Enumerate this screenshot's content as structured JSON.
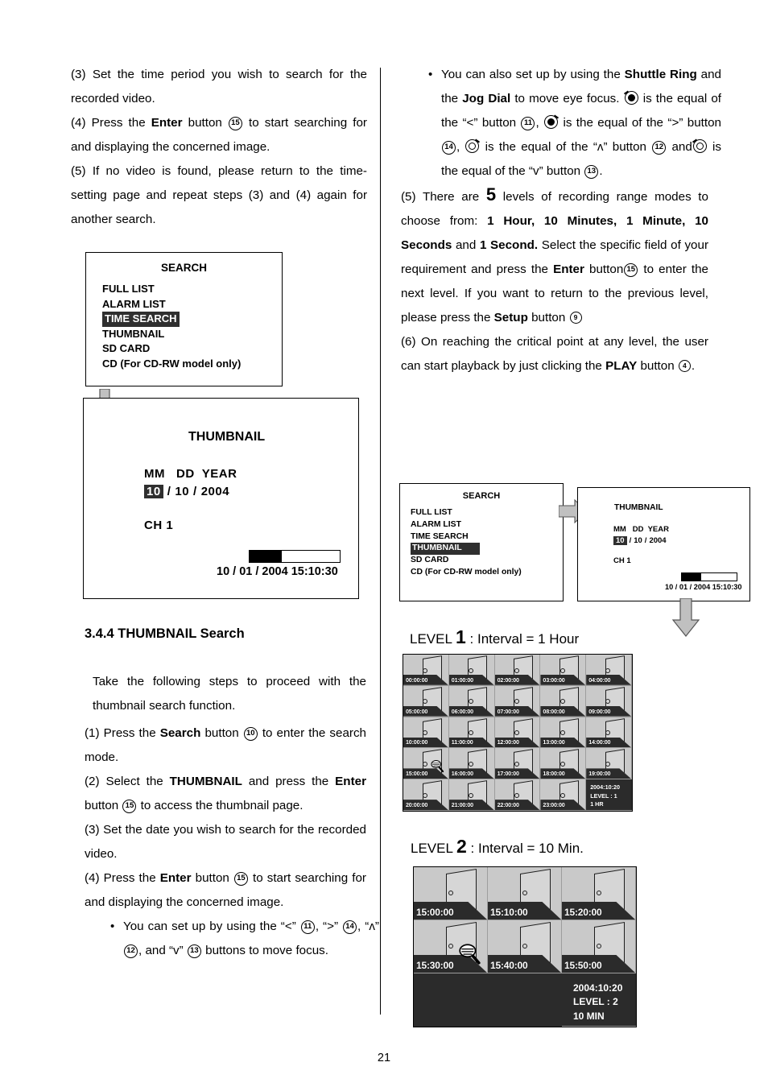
{
  "page": {
    "number": "21"
  },
  "left_column": {
    "steps": [
      {
        "label": "(3)",
        "text": "Set the time period you wish to search for the recorded video."
      },
      {
        "label": "(4)",
        "text_a": "Press the ",
        "bold_a": "Enter",
        "text_b": " button ",
        "badge": "15",
        "text_c": " to start searching for and displaying the concerned image."
      },
      {
        "label": "(5)",
        "text": "If no video is found, please return to the time-setting page and repeat steps (3) and (4) again for another search."
      }
    ],
    "search_menu": {
      "title": "SEARCH",
      "items": [
        {
          "label": "FULL LIST",
          "selected": false
        },
        {
          "label": "ALARM LIST",
          "selected": false
        },
        {
          "label": "TIME SEARCH",
          "selected": true
        },
        {
          "label": "THUMBNAIL",
          "selected": false
        },
        {
          "label": "SD CARD",
          "selected": false
        },
        {
          "label": "CD (For CD-RW model only)",
          "selected": false
        }
      ]
    },
    "thumbnail_dialog": {
      "title": "THUMBNAIL",
      "date_header": "MM   DD  YEAR",
      "month": "10",
      "sep1": "/",
      "day": "10",
      "sep2": "/",
      "year": "2004",
      "channel": "CH  1",
      "timestamp": "10 / 01 / 2004 15:10:30",
      "progress_percent": 36
    },
    "heading": "3.4.4 THUMBNAIL Search",
    "intro": "Take the following steps to proceed with the thumbnail search function.",
    "steps2": [
      {
        "label": "(1)",
        "a": "Press the ",
        "bold": "Search",
        "b": " button ",
        "badge": "10",
        "c": " to enter the search mode."
      },
      {
        "label": "(2)",
        "a": "Select the ",
        "bold": "THUMBNAIL",
        "b": " and press the ",
        "bold2": "Enter",
        "b2": " button ",
        "badge": "15",
        "c": " to access the thumbnail page."
      },
      {
        "label": "(3)",
        "a": "Set the date you wish to search for the recorded video."
      },
      {
        "label": "(4)",
        "a": "Press the ",
        "bold": "Enter",
        "b": " button ",
        "badge": "15",
        "c": " to start searching for and displaying the concerned image."
      }
    ],
    "bullet": {
      "a": "You can set up by using the “<” ",
      "badge1": "11",
      "b": ", “>” ",
      "badge2": "14",
      "c": ", “ʌ” ",
      "badge3": "12",
      "d": ", and “v” ",
      "badge4": "13",
      "e": " buttons to move focus."
    }
  },
  "right_column": {
    "bullet": {
      "a": "You can also set up by using the ",
      "bold1": "Shuttle Ring",
      "b": " and the ",
      "bold2": "Jog Dial",
      "c": " to move eye focus. ",
      "d": " is the equal of the “<” button ",
      "badge1": "11",
      "e": ", ",
      "f": " is the equal of the “>” button ",
      "badge2": "14",
      "g": ", ",
      "h": " is the equal of the “ʌ” button ",
      "badge3": "12",
      "i": " and",
      "j": " is the equal of the “v” button ",
      "badge4": "13",
      "k": "."
    },
    "step5": {
      "label": "(5)",
      "a": "There are ",
      "count": "5",
      "b": " levels of recording range modes to choose from: ",
      "modes_bold": "1 Hour, 10 Minutes, 1 Minute, 10 Seconds",
      "c": " and ",
      "modes_bold2": "1 Second.",
      "d": " Select the specific field of your requirement and press the ",
      "enter_bold": "Enter",
      "e": " button",
      "badge": "15",
      "f": " to enter the next level. If you want to return to the previous level, please press the ",
      "setup_bold": "Setup",
      "g": " button ",
      "badge2": "9"
    },
    "step6": {
      "label": "(6)",
      "a": "On reaching the critical point at any level, the user can start playback by just clicking the ",
      "bold": "PLAY",
      "b": " button ",
      "badge": "4",
      "c": "."
    },
    "search_menu": {
      "title": "SEARCH",
      "items": [
        {
          "label": "FULL LIST",
          "selected": false
        },
        {
          "label": "ALARM LIST",
          "selected": false
        },
        {
          "label": "TIME SEARCH",
          "selected": false
        },
        {
          "label": "THUMBNAIL",
          "selected": true
        },
        {
          "label": "SD CARD",
          "selected": false
        },
        {
          "label": "CD (For CD-RW model only)",
          "selected": false
        }
      ]
    },
    "thumbnail_dialog": {
      "title": "THUMBNAIL",
      "date_header": "MM   DD  YEAR",
      "month": "10",
      "sep1": "/",
      "day": "10",
      "sep2": "/",
      "year": "2004",
      "channel": "CH  1",
      "timestamp": "10 / 01 / 2004 15:10:30",
      "progress_percent": 36
    },
    "level1": {
      "label_pre": "LEVEL ",
      "label_num": "1",
      "label_post": " : Interval = 1 Hour",
      "times": [
        "00:00:00",
        "01:00:00",
        "02:00:00",
        "03:00:00",
        "04:00:00",
        "05:00:00",
        "06:00:00",
        "07:00:00",
        "08:00:00",
        "09:00:00",
        "10:00:00",
        "11:00:00",
        "12:00:00",
        "13:00:00",
        "14:00:00",
        "15:00:00",
        "16:00:00",
        "17:00:00",
        "18:00:00",
        "19:00:00",
        "20:00:00",
        "21:00:00",
        "22:00:00",
        "23:00:00"
      ],
      "cursor_index": 15,
      "info": {
        "date": "2004:10:20",
        "level": "LEVEL : 1",
        "interval": "1 HR"
      }
    },
    "level2": {
      "label_pre": "LEVEL ",
      "label_num": "2",
      "label_post": " : Interval = 10 Min.",
      "times": [
        "15:00:00",
        "15:10:00",
        "15:20:00",
        "15:30:00",
        "15:40:00",
        "15:50:00"
      ],
      "cursor_index": 3,
      "info": {
        "date": "2004:10:20",
        "level": "LEVEL : 2",
        "interval": "10 MIN"
      }
    }
  }
}
